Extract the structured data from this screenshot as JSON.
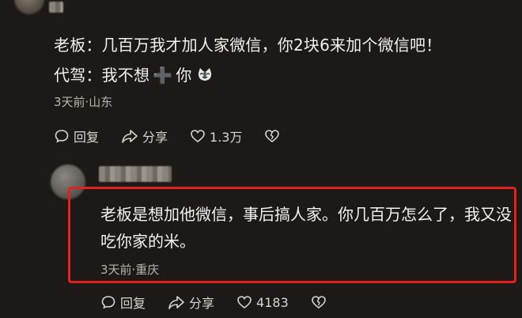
{
  "comment1": {
    "line1": "老板：几百万我才加人家微信，你2块6来加个微信吧！",
    "line2_prefix": "代驾：我不想",
    "line2_plus": "➕",
    "line2_suffix": "你",
    "meta": "3天前·山东",
    "actions": {
      "reply_label": "回复",
      "share_label": "分享",
      "like_count": "1.3万"
    }
  },
  "comment2": {
    "text": "老板是想加他微信，事后搞人家。你几百万怎么了，我又没吃你家的米。",
    "meta": "3天前·重庆",
    "actions": {
      "reply_label": "回复",
      "share_label": "分享",
      "like_count": "4183"
    }
  },
  "colors": {
    "background": "#1c1917",
    "highlight": "#e3201b",
    "text": "#f3f1ee",
    "meta": "#b9b4ad"
  },
  "icons": [
    "reply-icon",
    "share-icon",
    "heart-icon",
    "dislike-heart-icon",
    "cat-emoji-icon"
  ]
}
